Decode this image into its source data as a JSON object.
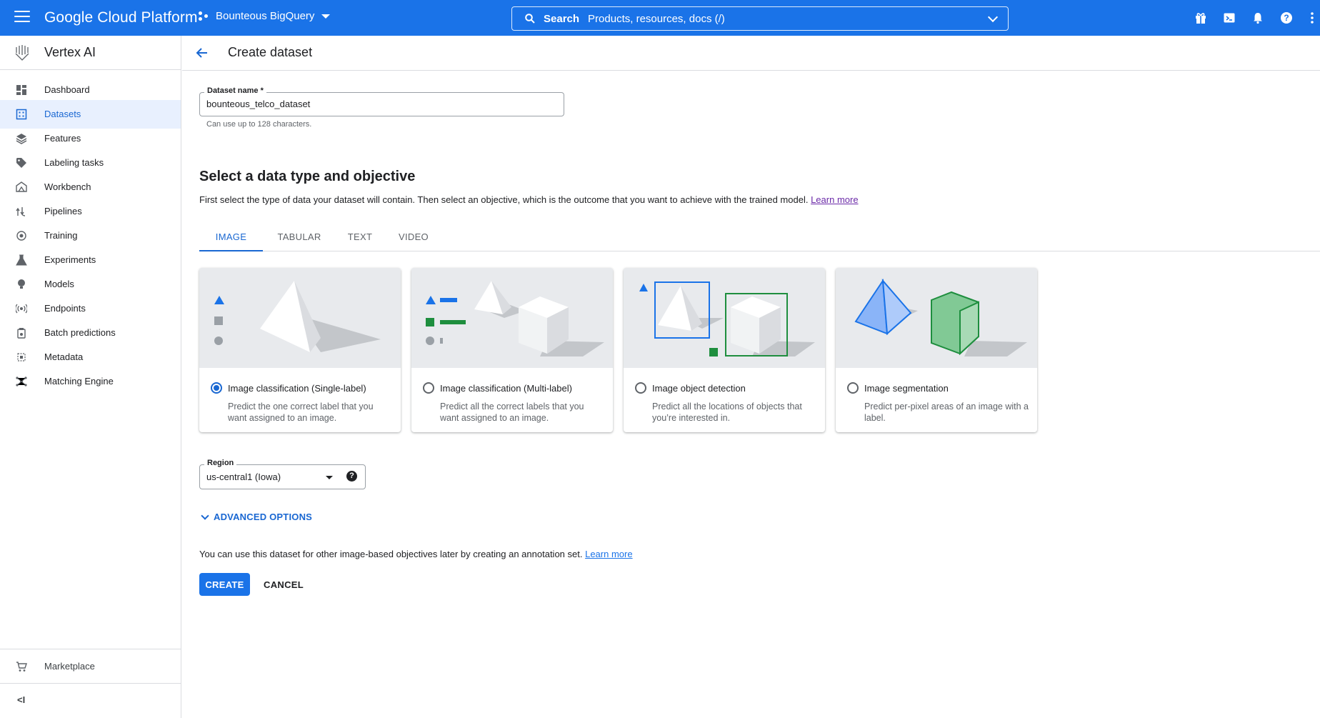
{
  "topbar": {
    "brand": "Google Cloud Platform",
    "project": "Bounteous BigQuery",
    "search_label": "Search",
    "search_placeholder": "Products, resources, docs (/)"
  },
  "sidebar": {
    "product": "Vertex AI",
    "items": [
      {
        "label": "Dashboard",
        "icon": "dashboard-icon"
      },
      {
        "label": "Datasets",
        "icon": "datasets-icon",
        "active": true
      },
      {
        "label": "Features",
        "icon": "features-icon"
      },
      {
        "label": "Labeling tasks",
        "icon": "tag-icon"
      },
      {
        "label": "Workbench",
        "icon": "workbench-icon"
      },
      {
        "label": "Pipelines",
        "icon": "pipelines-icon"
      },
      {
        "label": "Training",
        "icon": "training-icon"
      },
      {
        "label": "Experiments",
        "icon": "flask-icon"
      },
      {
        "label": "Models",
        "icon": "lightbulb-icon"
      },
      {
        "label": "Endpoints",
        "icon": "endpoints-icon"
      },
      {
        "label": "Batch predictions",
        "icon": "batch-icon"
      },
      {
        "label": "Metadata",
        "icon": "metadata-icon"
      },
      {
        "label": "Matching Engine",
        "icon": "matching-icon"
      }
    ],
    "marketplace": "Marketplace",
    "collapse": "<I"
  },
  "page": {
    "title": "Create dataset",
    "dataset_name": {
      "label": "Dataset name *",
      "value": "bounteous_telco_dataset",
      "hint": "Can use up to 128 characters."
    },
    "section_title": "Select a data type and objective",
    "section_desc": "First select the type of data your dataset will contain. Then select an objective, which is the outcome that you want to achieve with the trained model.",
    "learn_more": "Learn more",
    "tabs": [
      "IMAGE",
      "TABULAR",
      "TEXT",
      "VIDEO"
    ],
    "active_tab": "IMAGE",
    "cards": [
      {
        "title": "Image classification (Single-label)",
        "desc": "Predict the one correct label that you want assigned to an image.",
        "selected": true
      },
      {
        "title": "Image classification (Multi-label)",
        "desc": "Predict all the correct labels that you want assigned to an image.",
        "selected": false
      },
      {
        "title": "Image object detection",
        "desc": "Predict all the locations of objects that you’re interested in.",
        "selected": false
      },
      {
        "title": "Image segmentation",
        "desc": "Predict per-pixel areas of an image with a label.",
        "selected": false
      }
    ],
    "region": {
      "label": "Region",
      "value": "us-central1 (Iowa)"
    },
    "advanced": "ADVANCED OPTIONS",
    "note": "You can use this dataset for other image-based objectives later by creating an annotation set.",
    "note_link": "Learn more",
    "create": "CREATE",
    "cancel": "CANCEL"
  },
  "colors": {
    "primary": "#1a73e8",
    "active_text": "#1967d2",
    "active_bg": "#e8f0fe",
    "green": "#1e8e3e"
  }
}
